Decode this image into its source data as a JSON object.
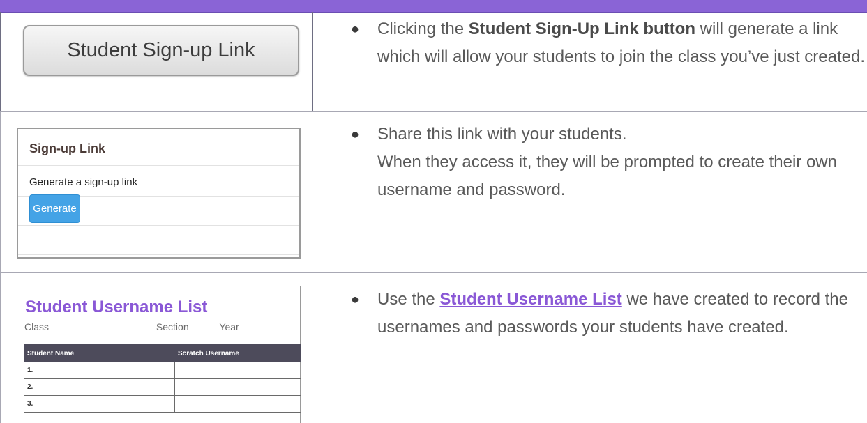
{
  "colors": {
    "header_bar": "#8a64d6",
    "accent_purple": "#8a58d6",
    "generate_blue": "#44a3e6",
    "table_header": "#4d4b5b"
  },
  "row1": {
    "button_label": "Student Sign-up Link",
    "text_before": "Clicking the ",
    "text_bold": "Student Sign-Up Link button",
    "text_after": " will generate a link which will allow your students to join the class you’ve just created."
  },
  "row2": {
    "panel_title": "Sign-up Link",
    "panel_subtitle": "Generate a sign-up link",
    "generate_label": "Generate",
    "line1": "Share this link with your students.",
    "line2": "When they access it, they will be prompted to create their own username and password."
  },
  "row3": {
    "list_title": "Student Username List",
    "meta_class": "Class",
    "meta_section": "Section",
    "meta_year": "Year",
    "col_name": "Student Name",
    "col_username": "Scratch Username",
    "rows": [
      "1.",
      "2.",
      "3."
    ],
    "text_before": "Use the ",
    "text_link": "Student Username List",
    "text_after": " we have created to record the usernames and passwords your students have created."
  }
}
